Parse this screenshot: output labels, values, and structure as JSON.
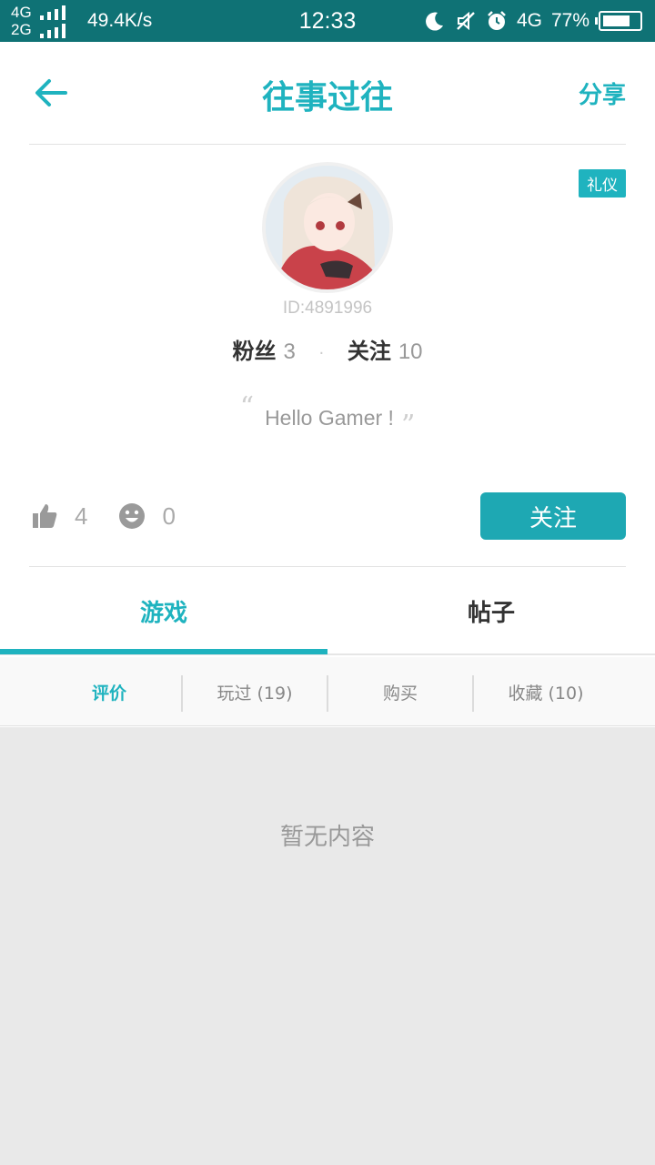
{
  "status_bar": {
    "network_top": "4G",
    "network_bottom": "2G",
    "speed": "49.4K/s",
    "time": "12:33",
    "network_right": "4G",
    "battery": "77%",
    "battery_level": 0.77,
    "icons": [
      "moon-icon",
      "mute-icon",
      "alarm-icon",
      "battery-icon"
    ]
  },
  "header": {
    "title": "往事过往",
    "share_label": "分享",
    "back_icon": "arrow-left-icon"
  },
  "profile": {
    "badge": "礼仪",
    "user_id": "ID:4891996",
    "fans_label": "粉丝",
    "fans_count": "3",
    "following_label": "关注",
    "following_count": "10",
    "bio": "Hello Gamer !"
  },
  "reactions": {
    "likes": "4",
    "smiles": "0"
  },
  "follow_button": "关注",
  "tabs": [
    {
      "label": "游戏",
      "active": true
    },
    {
      "label": "帖子",
      "active": false
    }
  ],
  "subtabs": [
    {
      "label": "评价",
      "active": true
    },
    {
      "label": "玩过 (19)",
      "active": false
    },
    {
      "label": "购买",
      "active": false
    },
    {
      "label": "收藏 (10)",
      "active": false
    }
  ],
  "empty_state": "暂无内容",
  "colors": {
    "accent": "#1fb3bf",
    "status_bar": "#0f7275",
    "button": "#1ea8b3"
  }
}
